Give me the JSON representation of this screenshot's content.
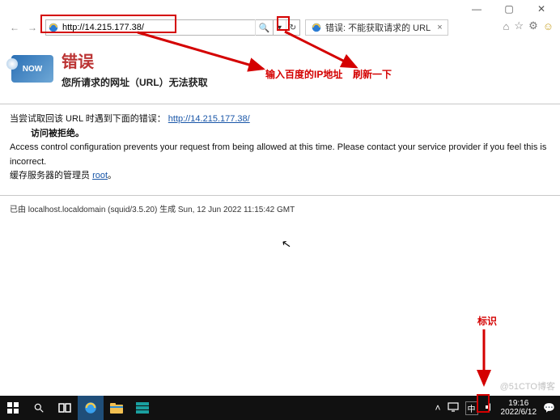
{
  "window_controls": {
    "minimize": "—",
    "maximize": "▢",
    "close": "✕"
  },
  "nav": {
    "back": "←",
    "forward": "→"
  },
  "addressbar": {
    "url": "http://14.215.177.38/",
    "search_icon": "🔍",
    "dropdown": "▾",
    "refresh": "↻"
  },
  "tab": {
    "title": "错误: 不能获取请求的 URL",
    "close": "×"
  },
  "toolbar_right": {
    "home": "⌂",
    "fav": "☆",
    "gear": "⚙",
    "smile": "☺"
  },
  "error": {
    "badge": "NOW",
    "title": "错误",
    "subtitle": "您所请求的网址（URL）无法获取",
    "line1_pre": "当尝试取回该 URL 时遇到下面的错误：",
    "line1_link": "http://14.215.177.38/",
    "line2": "访问被拒绝。",
    "line3_pre": "Access control configuration prevents your request from being allowed at this time. Please contact your service provider if you feel this is incorrect.",
    "line4_pre": "缓存服务器的管理员 ",
    "line4_link": "root",
    "line4_post": "。",
    "footer": "已由 localhost.localdomain (squid/3.5.20) 生成 Sun, 12 Jun 2022 11:15:42 GMT"
  },
  "annotations": {
    "url": "输入百度的IP地址",
    "refresh": "刷新一下",
    "tray": "标识"
  },
  "taskbar": {
    "chevron": "˄",
    "ime": "中",
    "time": "19:16",
    "date": "2022/6/12",
    "notif": "💬"
  },
  "watermark": "@51CTO博客"
}
